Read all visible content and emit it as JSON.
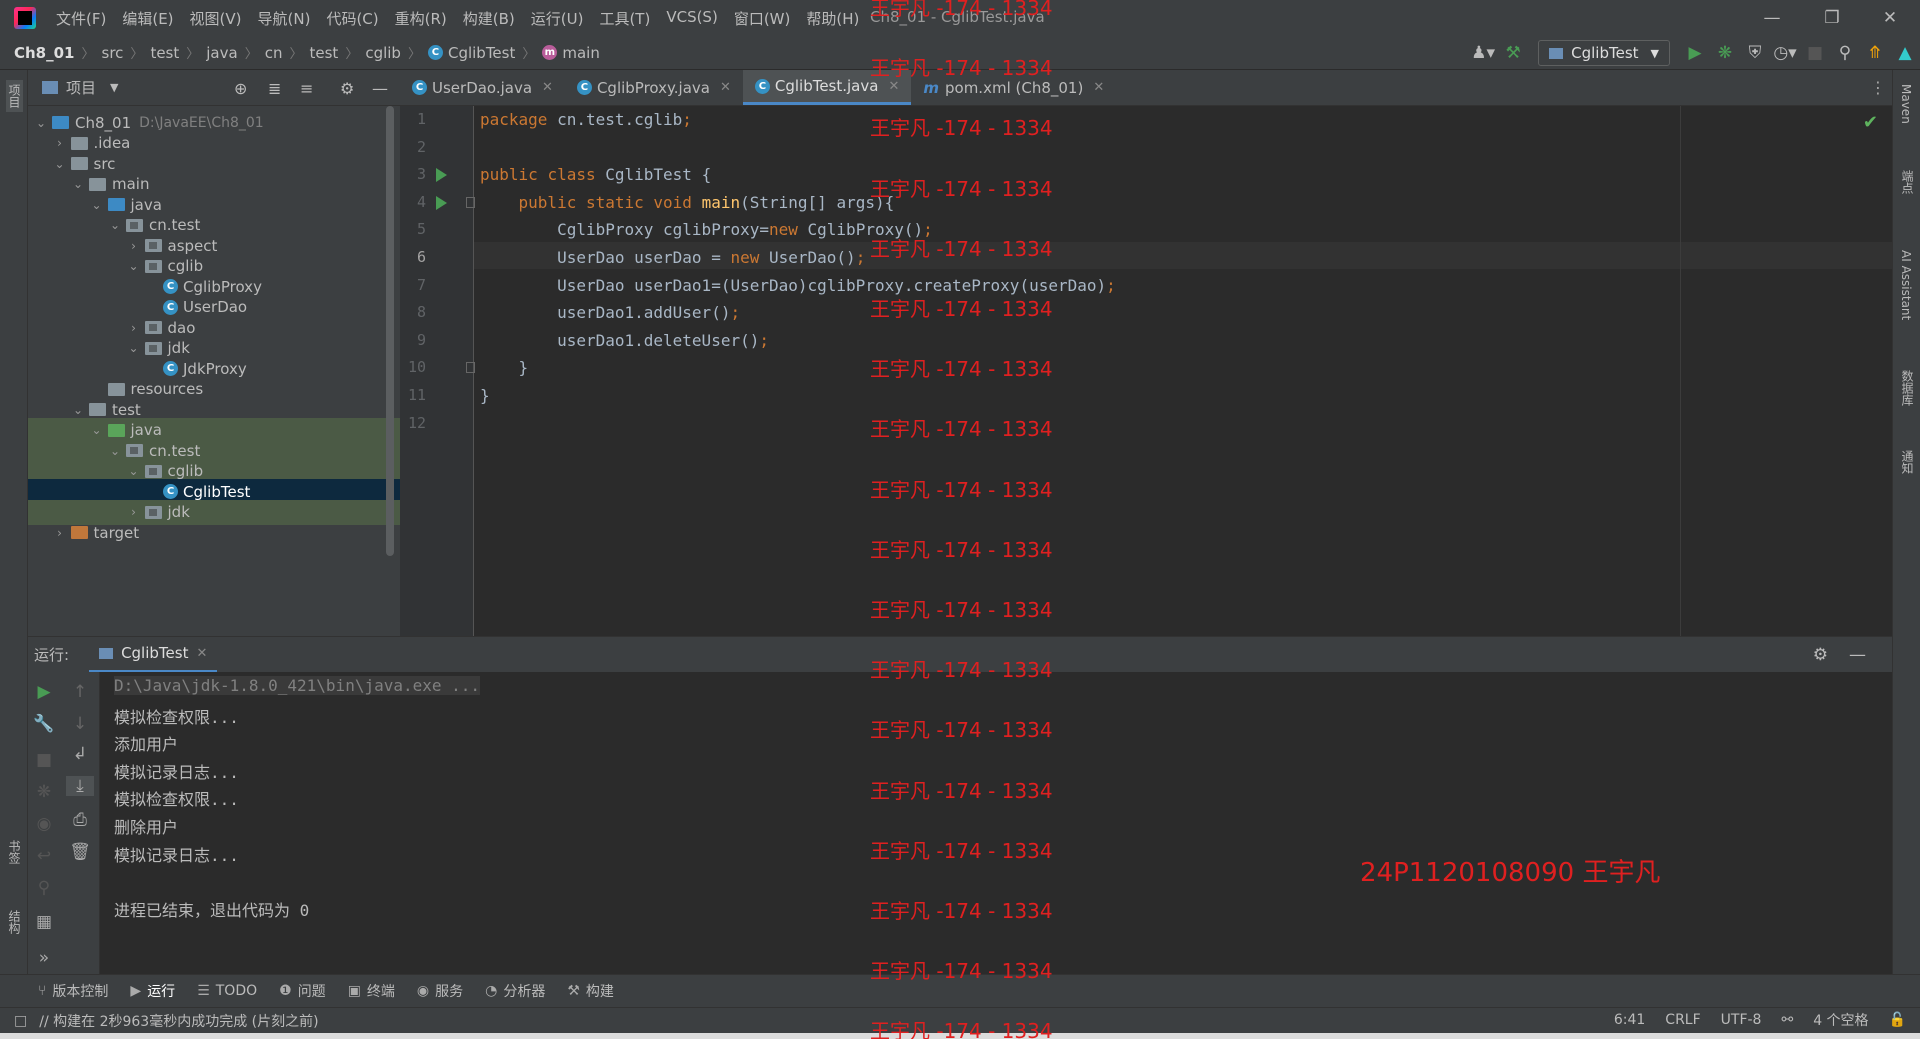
{
  "window": {
    "title": "Ch8_01 - CglibTest.java",
    "menu": [
      "文件(F)",
      "编辑(E)",
      "视图(V)",
      "导航(N)",
      "代码(C)",
      "重构(R)",
      "构建(B)",
      "运行(U)",
      "工具(T)",
      "VCS(S)",
      "窗口(W)",
      "帮助(H)"
    ],
    "minimize": "—",
    "restore": "❐",
    "close": "✕"
  },
  "breadcrumb": [
    "Ch8_01",
    "src",
    "test",
    "java",
    "cn",
    "test",
    "cglib",
    "CglibTest",
    "main"
  ],
  "toolbar": {
    "run_config": "CglibTest"
  },
  "left_strip": {
    "project": "项目",
    "bookmarks": "书签",
    "structure": "结构"
  },
  "right_strip": {
    "maven": "Maven",
    "endpoints": "端点",
    "ai": "AI Assistant",
    "database": "数据库",
    "notifications": "通知"
  },
  "project_panel": {
    "title": "项目",
    "tree": [
      {
        "label": "Ch8_01",
        "path": "D:\\JavaEE\\Ch8_01",
        "depth": 0,
        "type": "module",
        "expanded": true
      },
      {
        "label": ".idea",
        "depth": 1,
        "type": "folder",
        "expanded": false
      },
      {
        "label": "src",
        "depth": 1,
        "type": "folder",
        "expanded": true
      },
      {
        "label": "main",
        "depth": 2,
        "type": "folder",
        "expanded": true
      },
      {
        "label": "java",
        "depth": 3,
        "type": "src",
        "expanded": true
      },
      {
        "label": "cn.test",
        "depth": 4,
        "type": "package",
        "expanded": true
      },
      {
        "label": "aspect",
        "depth": 5,
        "type": "package",
        "expanded": false
      },
      {
        "label": "cglib",
        "depth": 5,
        "type": "package",
        "expanded": true
      },
      {
        "label": "CglibProxy",
        "depth": 6,
        "type": "class"
      },
      {
        "label": "UserDao",
        "depth": 6,
        "type": "class"
      },
      {
        "label": "dao",
        "depth": 5,
        "type": "package",
        "expanded": false
      },
      {
        "label": "jdk",
        "depth": 5,
        "type": "package",
        "expanded": true
      },
      {
        "label": "JdkProxy",
        "depth": 6,
        "type": "class"
      },
      {
        "label": "resources",
        "depth": 3,
        "type": "folder"
      },
      {
        "label": "test",
        "depth": 2,
        "type": "folder",
        "expanded": true
      },
      {
        "label": "java",
        "depth": 3,
        "type": "test",
        "expanded": true,
        "hl": true
      },
      {
        "label": "cn.test",
        "depth": 4,
        "type": "package",
        "expanded": true,
        "hl": true
      },
      {
        "label": "cglib",
        "depth": 5,
        "type": "package",
        "expanded": true,
        "hl": true
      },
      {
        "label": "CglibTest",
        "depth": 6,
        "type": "class",
        "selected": true
      },
      {
        "label": "jdk",
        "depth": 5,
        "type": "package",
        "expanded": false,
        "hl": true
      },
      {
        "label": "target",
        "depth": 1,
        "type": "excluded",
        "expanded": false
      }
    ]
  },
  "editor": {
    "tabs": [
      {
        "label": "UserDao.java",
        "icon": "C",
        "active": false
      },
      {
        "label": "CglibProxy.java",
        "icon": "C",
        "active": false
      },
      {
        "label": "CglibTest.java",
        "icon": "C",
        "active": true
      },
      {
        "label": "pom.xml (Ch8_01)",
        "icon": "m",
        "active": false
      }
    ],
    "current_line": 6,
    "lines": [
      "package cn.test.cglib;",
      "",
      "public class CglibTest {",
      "    public static void main(String[] args){",
      "        CglibProxy cglibProxy=new CglibProxy();",
      "        UserDao userDao = new UserDao();",
      "        UserDao userDao1=(UserDao)cglibProxy.createProxy(userDao);",
      "        userDao1.addUser();",
      "        userDao1.deleteUser();",
      "    }",
      "}",
      ""
    ]
  },
  "run_panel": {
    "label": "运行:",
    "tab": "CglibTest",
    "console": [
      "D:\\Java\\jdk-1.8.0_421\\bin\\java.exe ...",
      "模拟检查权限...",
      "添加用户",
      "模拟记录日志...",
      "模拟检查权限...",
      "删除用户",
      "模拟记录日志...",
      "",
      "进程已结束，退出代码为 0"
    ]
  },
  "tool_windows": [
    {
      "label": "版本控制",
      "glyph": "⑂"
    },
    {
      "label": "运行",
      "glyph": "▶",
      "active": true
    },
    {
      "label": "TODO",
      "glyph": "☰"
    },
    {
      "label": "问题",
      "glyph": "❶"
    },
    {
      "label": "终端",
      "glyph": "▣"
    },
    {
      "label": "服务",
      "glyph": "◉"
    },
    {
      "label": "分析器",
      "glyph": "◔"
    },
    {
      "label": "构建",
      "glyph": "⚒"
    }
  ],
  "status": {
    "message": "// 构建在 2秒963毫秒内成功完成 (片刻之前)",
    "position": "6:41",
    "line_sep": "CRLF",
    "encoding": "UTF-8",
    "indent": "4 个空格"
  },
  "watermark": {
    "text": "王宇凡 -174 - 1334",
    "stamp": "24P1120108090 王宇凡"
  },
  "colors": {
    "accent": "#4a88c7",
    "keyword": "#cc7832",
    "method": "#ffc66d",
    "watermark": "#e02020"
  }
}
